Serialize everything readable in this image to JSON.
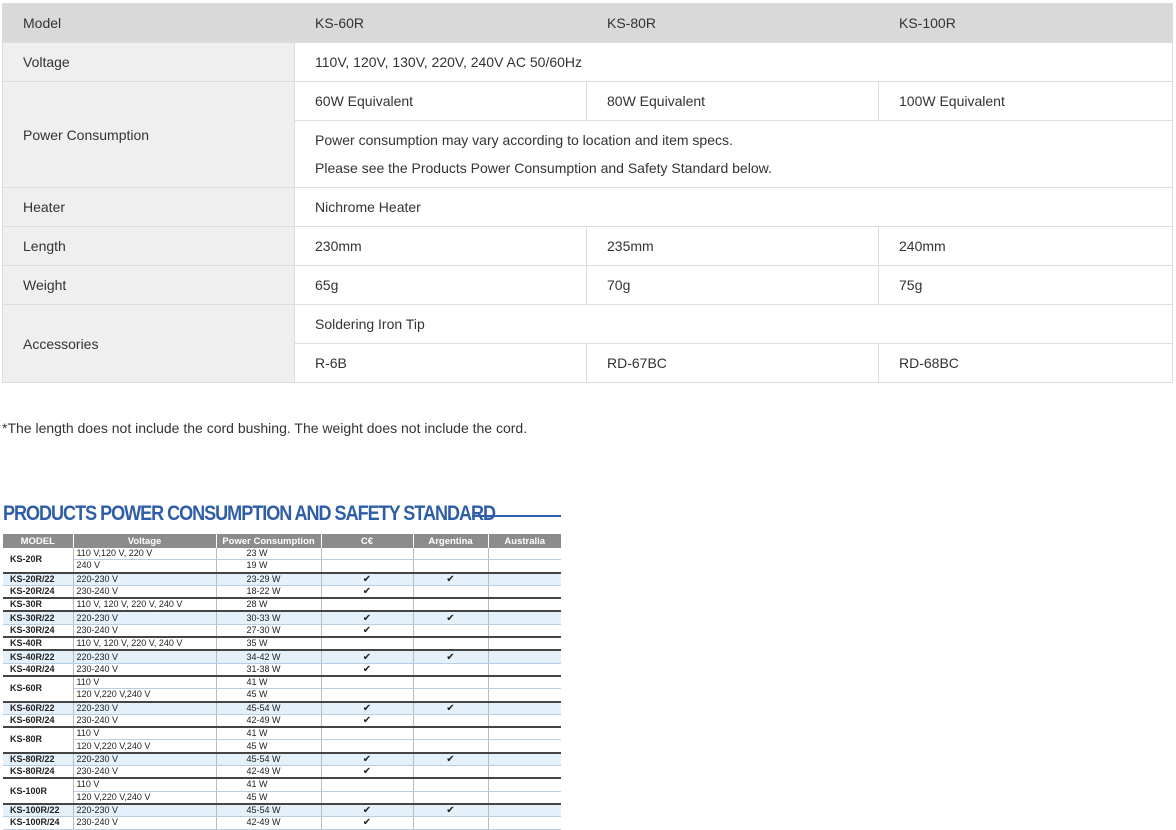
{
  "spec": {
    "header": {
      "label": "Model",
      "models": [
        "KS-60R",
        "KS-80R",
        "KS-100R"
      ]
    },
    "voltage": {
      "label": "Voltage",
      "value": "110V, 120V, 130V, 220V, 240V AC 50/60Hz"
    },
    "power": {
      "label": "Power Consumption",
      "values": [
        "60W Equivalent",
        "80W Equivalent",
        "100W Equivalent"
      ],
      "note_line1": "Power consumption may vary according to location and item specs.",
      "note_line2": "Please see the Products Power Consumption and Safety Standard below."
    },
    "heater": {
      "label": "Heater",
      "value": "Nichrome Heater"
    },
    "length": {
      "label": "Length",
      "values": [
        "230mm",
        "235mm",
        "240mm"
      ]
    },
    "weight": {
      "label": "Weight",
      "values": [
        "65g",
        "70g",
        "75g"
      ]
    },
    "accessories": {
      "label": "Accessories",
      "title": "Soldering Iron Tip",
      "values": [
        "R-6B",
        "RD-67BC",
        "RD-68BC"
      ]
    }
  },
  "footnote": "*The length does not include the cord bushing. The weight does not include the cord.",
  "ps": {
    "title": "PRODUCTS POWER CONSUMPTION AND SAFETY STANDARD",
    "headers": {
      "model": "MODEL",
      "voltage": "Voltage",
      "power": "Power Consumption",
      "ce": "C€",
      "argentina": "Argentina",
      "australia": "Australia"
    },
    "check": "✔",
    "rows": [
      {
        "model": "KS-20R",
        "voltage": "110 V,120 V, 220 V",
        "power": "23 W",
        "ce": "",
        "ar": ""
      },
      {
        "model": "",
        "voltage": "240 V",
        "power": "19 W",
        "ce": "",
        "ar": ""
      },
      {
        "model": "KS-20R/22",
        "voltage": "220-230 V",
        "power": "23-29 W",
        "ce": "✔",
        "ar": "✔"
      },
      {
        "model": "KS-20R/24",
        "voltage": "230-240 V",
        "power": "18-22 W",
        "ce": "✔",
        "ar": ""
      },
      {
        "model": "KS-30R",
        "voltage": "110 V, 120 V, 220 V, 240 V",
        "power": "28 W",
        "ce": "",
        "ar": ""
      },
      {
        "model": "KS-30R/22",
        "voltage": "220-230 V",
        "power": "30-33 W",
        "ce": "✔",
        "ar": "✔"
      },
      {
        "model": "KS-30R/24",
        "voltage": "230-240 V",
        "power": "27-30 W",
        "ce": "✔",
        "ar": ""
      },
      {
        "model": "KS-40R",
        "voltage": "110 V, 120 V, 220 V, 240 V",
        "power": "35 W",
        "ce": "",
        "ar": ""
      },
      {
        "model": "KS-40R/22",
        "voltage": "220-230 V",
        "power": "34-42 W",
        "ce": "✔",
        "ar": "✔"
      },
      {
        "model": "KS-40R/24",
        "voltage": "230-240 V",
        "power": "31-38 W",
        "ce": "✔",
        "ar": ""
      },
      {
        "model": "KS-60R",
        "voltage": "110 V",
        "power": "41 W",
        "ce": "",
        "ar": ""
      },
      {
        "model": "",
        "voltage": "120 V,220 V,240 V",
        "power": "45 W",
        "ce": "",
        "ar": ""
      },
      {
        "model": "KS-60R/22",
        "voltage": "220-230 V",
        "power": "45-54 W",
        "ce": "✔",
        "ar": "✔"
      },
      {
        "model": "KS-60R/24",
        "voltage": "230-240 V",
        "power": "42-49 W",
        "ce": "✔",
        "ar": ""
      },
      {
        "model": "KS-80R",
        "voltage": "110 V",
        "power": "41 W",
        "ce": "",
        "ar": ""
      },
      {
        "model": "",
        "voltage": "120 V,220 V,240 V",
        "power": "45 W",
        "ce": "",
        "ar": ""
      },
      {
        "model": "KS-80R/22",
        "voltage": "220-230 V",
        "power": "45-54 W",
        "ce": "✔",
        "ar": "✔"
      },
      {
        "model": "KS-80R/24",
        "voltage": "230-240 V",
        "power": "42-49 W",
        "ce": "✔",
        "ar": ""
      },
      {
        "model": "KS-100R",
        "voltage": "110 V",
        "power": "41 W",
        "ce": "",
        "ar": ""
      },
      {
        "model": "",
        "voltage": "120 V,220 V,240 V",
        "power": "45 W",
        "ce": "",
        "ar": ""
      },
      {
        "model": "KS-100R/22",
        "voltage": "220-230 V",
        "power": "45-54 W",
        "ce": "✔",
        "ar": "✔"
      },
      {
        "model": "KS-100R/24",
        "voltage": "230-240 V",
        "power": "42-49 W",
        "ce": "✔",
        "ar": ""
      }
    ]
  }
}
